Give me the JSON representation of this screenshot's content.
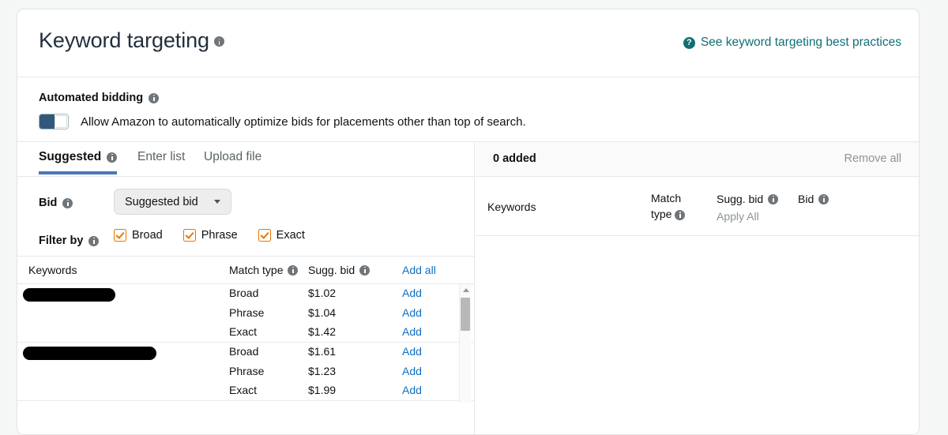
{
  "header": {
    "title": "Keyword targeting",
    "title_info_icon": "info-icon",
    "best_practices_icon": "question-circle-icon",
    "best_practices_label": "See keyword targeting best practices"
  },
  "automated_bidding": {
    "title": "Automated bidding",
    "title_info_icon": "info-icon",
    "toggle_state": "on",
    "description": "Allow Amazon to automatically optimize bids for placements other than top of search."
  },
  "tabs": [
    {
      "label": "Suggested",
      "active": true,
      "info_icon": "info-icon"
    },
    {
      "label": "Enter list",
      "active": false
    },
    {
      "label": "Upload file",
      "active": false
    }
  ],
  "controls": {
    "bid_label": "Bid",
    "bid_info_icon": "info-icon",
    "bid_select_value": "Suggested bid",
    "bid_select_icon": "chevron-down-icon",
    "filter_label": "Filter by",
    "filter_info_icon": "info-icon",
    "filters": [
      {
        "label": "Broad",
        "checked": true
      },
      {
        "label": "Phrase",
        "checked": true
      },
      {
        "label": "Exact",
        "checked": true
      }
    ]
  },
  "suggested_table": {
    "columns": {
      "keywords": "Keywords",
      "match_type": "Match type",
      "sugg_bid": "Sugg. bid",
      "add_all": "Add all"
    },
    "rows": [
      {
        "keyword": "",
        "redacted": true,
        "redaction_width": 117,
        "entries": [
          {
            "match_type": "Broad",
            "sugg_bid": "$1.02",
            "action": "Add"
          },
          {
            "match_type": "Phrase",
            "sugg_bid": "$1.04",
            "action": "Add"
          },
          {
            "match_type": "Exact",
            "sugg_bid": "$1.42",
            "action": "Add"
          }
        ]
      },
      {
        "keyword": "",
        "redacted": true,
        "redaction_width": 169,
        "entries": [
          {
            "match_type": "Broad",
            "sugg_bid": "$1.61",
            "action": "Add"
          },
          {
            "match_type": "Phrase",
            "sugg_bid": "$1.23",
            "action": "Add"
          },
          {
            "match_type": "Exact",
            "sugg_bid": "$1.99",
            "action": "Add"
          }
        ]
      }
    ]
  },
  "added_panel": {
    "count_label": "0 added",
    "remove_all_label": "Remove all",
    "columns": {
      "keywords": "Keywords",
      "match_type": "Match type",
      "sugg_bid": "Sugg. bid",
      "apply_all": "Apply All",
      "bid": "Bid"
    },
    "rows": []
  },
  "colors": {
    "link_blue": "#0f6fc5",
    "link_teal": "#116f74",
    "tab_underline": "#4a76b8",
    "checkbox_orange": "#e77600",
    "toggle_fill": "#31587a",
    "page_background": "#f5f6f6"
  }
}
